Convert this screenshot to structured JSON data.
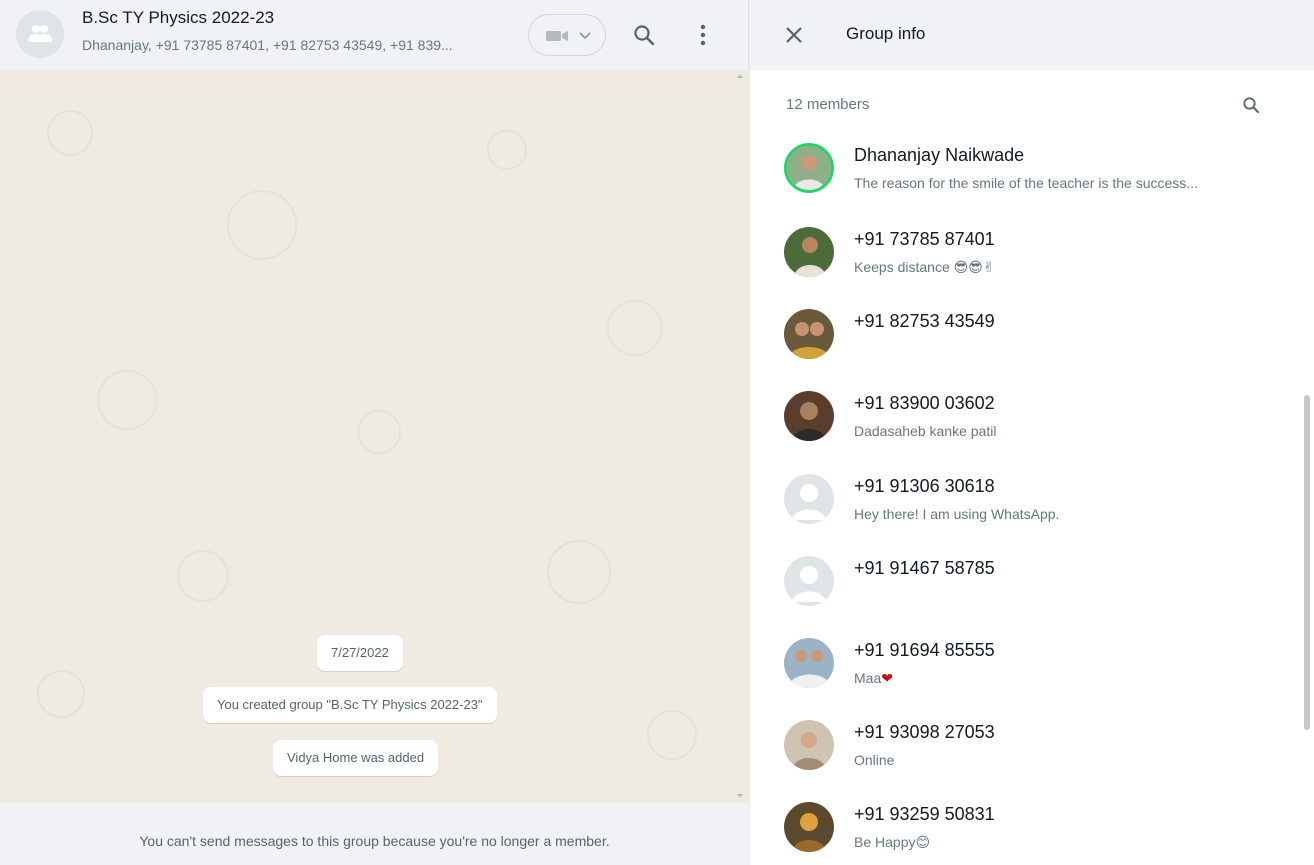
{
  "chat": {
    "title": "B.Sc TY Physics 2022-23",
    "subtitle": "Dhananjay, +91 73785 87401, +91 82753 43549, +91 839...",
    "messages": [
      {
        "text": "7/27/2022"
      },
      {
        "text": "You created group \"B.Sc TY Physics 2022-23\""
      },
      {
        "text": "Vidya Home was added"
      }
    ],
    "footer": "You can't send messages to this group because you're no longer a member."
  },
  "info": {
    "title": "Group info",
    "members_count": "12 members",
    "members": [
      {
        "name": "Dhananjay Naikwade",
        "about": "The reason for the smile of the teacher is the success...",
        "emoji": ""
      },
      {
        "name": "+91 73785 87401",
        "about": "Keeps distance",
        "emoji": "😎😎✌"
      },
      {
        "name": "+91 82753 43549",
        "about": "",
        "emoji": ""
      },
      {
        "name": "+91 83900 03602",
        "about": "Dadasaheb kanke patil",
        "emoji": ""
      },
      {
        "name": "+91 91306 30618",
        "about": "Hey there! I am using WhatsApp.",
        "emoji": ""
      },
      {
        "name": "+91 91467 58785",
        "about": "",
        "emoji": ""
      },
      {
        "name": "+91 91694 85555",
        "about": "Maa",
        "emoji": "❤"
      },
      {
        "name": "+91 93098 27053",
        "about": "Online",
        "emoji": ""
      },
      {
        "name": "+91 93259 50831",
        "about": "Be Happy",
        "emoji": "😊"
      }
    ]
  },
  "icons": {
    "group_avatar": "group-icon",
    "video": "video-camera-icon",
    "search": "search-icon",
    "menu": "menu-dots-icon",
    "close": "close-icon"
  },
  "colors": {
    "chat_bg": "#efeae2",
    "header_bg": "#f0f2f5",
    "primary_text": "#111b21",
    "secondary_text": "#667781",
    "online_ring": "#25d366"
  }
}
